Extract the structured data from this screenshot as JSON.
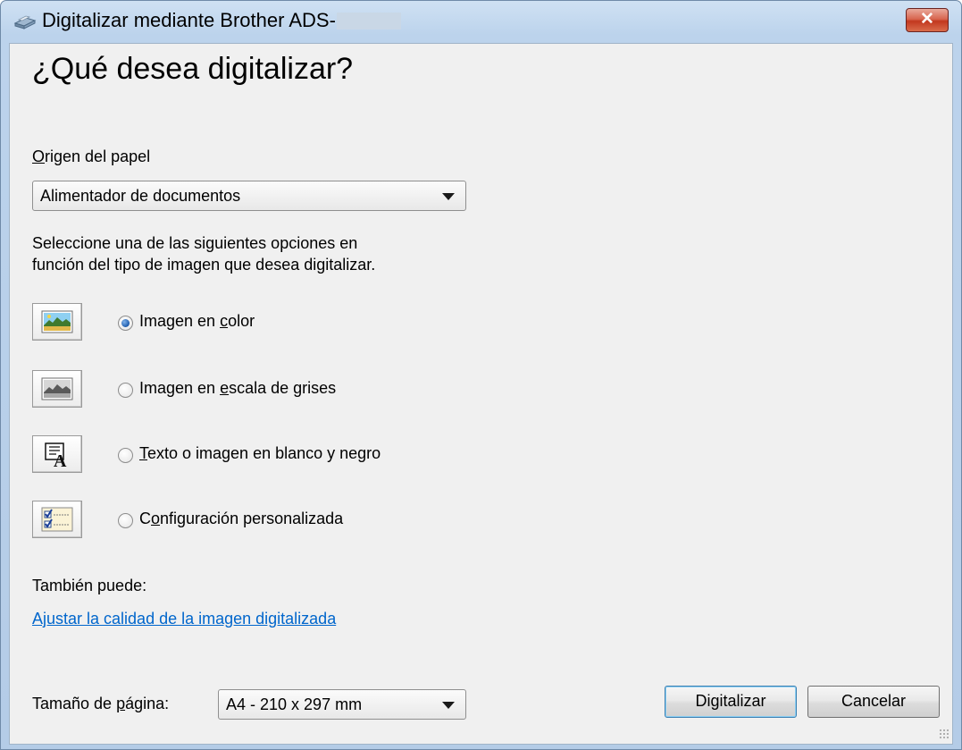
{
  "window": {
    "title": "Digitalizar mediante Brother ADS-",
    "close_label": "✕"
  },
  "heading": "¿Qué desea digitalizar?",
  "paper_source": {
    "label_first": "O",
    "label_rest": "rigen del papel",
    "selected": "Alimentador de documentos"
  },
  "description": {
    "line1": "Seleccione una de las siguientes opciones en",
    "line2": "función del tipo de imagen que desea digitalizar."
  },
  "options": [
    {
      "pre": "Imagen en ",
      "key": "c",
      "post": "olor",
      "checked": true,
      "icon": "color-photo-icon"
    },
    {
      "pre": "Imagen en ",
      "key": "e",
      "post": "scala de grises",
      "checked": false,
      "icon": "grayscale-photo-icon"
    },
    {
      "pre": "",
      "key": "T",
      "post": "exto o imagen en blanco y negro",
      "checked": false,
      "icon": "black-white-text-icon"
    },
    {
      "pre": "C",
      "key": "o",
      "post": "nfiguración personalizada",
      "checked": false,
      "icon": "custom-settings-checklist-icon"
    }
  ],
  "also": {
    "label": "También puede:",
    "link": "Ajustar la calidad de la imagen digitalizada"
  },
  "page_size": {
    "label_pre": "Tamaño de ",
    "label_key": "p",
    "label_post": "ágina:",
    "selected": "A4 - 210 x 297 mm"
  },
  "buttons": {
    "scan": "Digitalizar",
    "cancel": "Cancelar"
  },
  "colors": {
    "link": "#0066cc",
    "close_button": "#c2381f",
    "radio_selected": "#1e5cad"
  }
}
